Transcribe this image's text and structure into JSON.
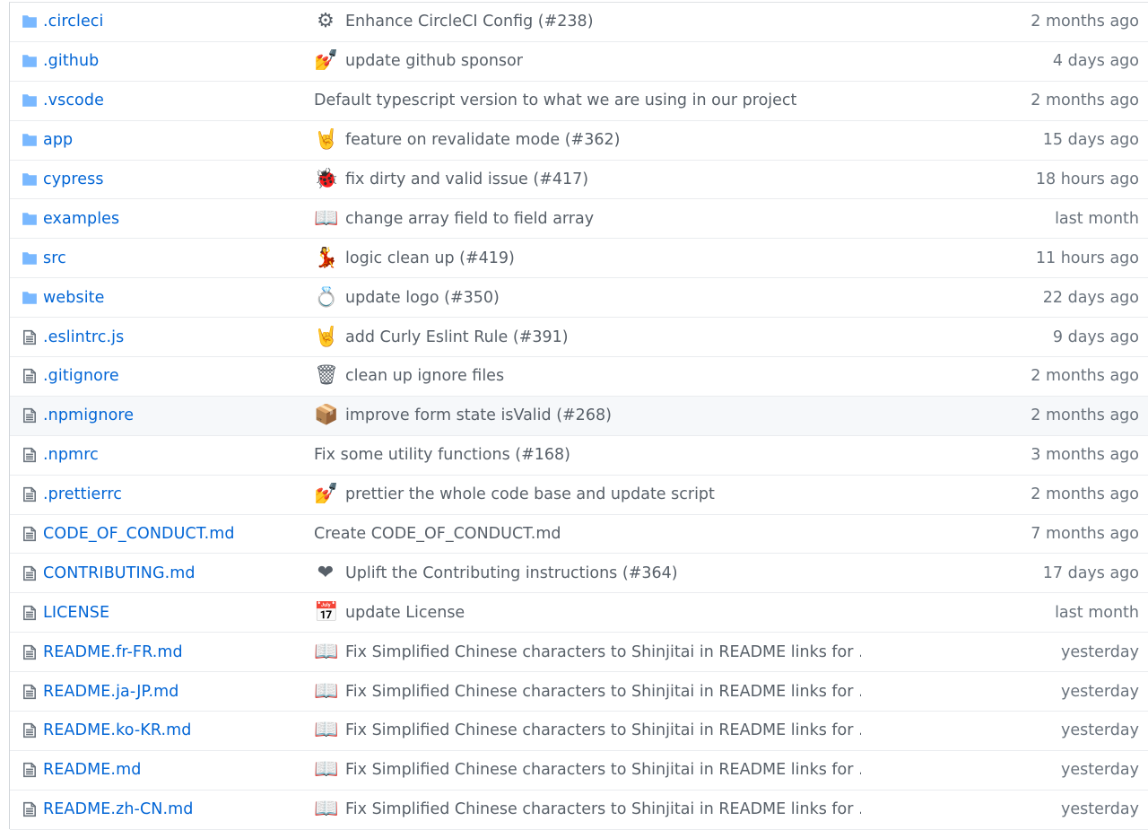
{
  "files": [
    {
      "name": ".circleci",
      "type": "folder",
      "emoji": "⚙",
      "message": "Enhance CircleCI Config (#238)",
      "age": "2 months ago"
    },
    {
      "name": ".github",
      "type": "folder",
      "emoji": "💅",
      "message": "update github sponsor",
      "age": "4 days ago"
    },
    {
      "name": ".vscode",
      "type": "folder",
      "emoji": "",
      "message": "Default typescript version to what we are using in our project",
      "age": "2 months ago"
    },
    {
      "name": "app",
      "type": "folder",
      "emoji": "🤘",
      "message": "feature on revalidate mode (#362)",
      "age": "15 days ago"
    },
    {
      "name": "cypress",
      "type": "folder",
      "emoji": "🐞",
      "message": "fix dirty and valid issue (#417)",
      "age": "18 hours ago"
    },
    {
      "name": "examples",
      "type": "folder",
      "emoji": "📖",
      "message": "change array field to field array",
      "age": "last month"
    },
    {
      "name": "src",
      "type": "folder",
      "emoji": "💃",
      "message": "logic clean up (#419)",
      "age": "11 hours ago"
    },
    {
      "name": "website",
      "type": "folder",
      "emoji": "💍",
      "message": "update logo (#350)",
      "age": "22 days ago"
    },
    {
      "name": ".eslintrc.js",
      "type": "file",
      "emoji": "🤘",
      "message": "add Curly Eslint Rule (#391)",
      "age": "9 days ago"
    },
    {
      "name": ".gitignore",
      "type": "file",
      "emoji": "🗑",
      "message": "clean up ignore files",
      "age": "2 months ago"
    },
    {
      "name": ".npmignore",
      "type": "file",
      "emoji": "📦",
      "message": "improve form state isValid (#268)",
      "age": "2 months ago"
    },
    {
      "name": ".npmrc",
      "type": "file",
      "emoji": "",
      "message": "Fix some utility functions (#168)",
      "age": "3 months ago"
    },
    {
      "name": ".prettierrc",
      "type": "file",
      "emoji": "💅",
      "message": "prettier the whole code base and update script",
      "age": "2 months ago"
    },
    {
      "name": "CODE_OF_CONDUCT.md",
      "type": "file",
      "emoji": "",
      "message": "Create CODE_OF_CONDUCT.md",
      "age": "7 months ago"
    },
    {
      "name": "CONTRIBUTING.md",
      "type": "file",
      "emoji": "❤",
      "message": "Uplift the Contributing instructions (#364)",
      "age": "17 days ago"
    },
    {
      "name": "LICENSE",
      "type": "file",
      "emoji": "📅",
      "message": "update License",
      "age": "last month"
    },
    {
      "name": "README.fr-FR.md",
      "type": "file",
      "emoji": "📖",
      "message": "Fix Simplified Chinese characters to Shinjitai in README links for …",
      "age": "yesterday"
    },
    {
      "name": "README.ja-JP.md",
      "type": "file",
      "emoji": "📖",
      "message": "Fix Simplified Chinese characters to Shinjitai in README links for …",
      "age": "yesterday"
    },
    {
      "name": "README.ko-KR.md",
      "type": "file",
      "emoji": "📖",
      "message": "Fix Simplified Chinese characters to Shinjitai in README links for …",
      "age": "yesterday"
    },
    {
      "name": "README.md",
      "type": "file",
      "emoji": "📖",
      "message": "Fix Simplified Chinese characters to Shinjitai in README links for …",
      "age": "yesterday"
    },
    {
      "name": "README.zh-CN.md",
      "type": "file",
      "emoji": "📖",
      "message": "Fix Simplified Chinese characters to Shinjitai in README links for …",
      "age": "yesterday"
    }
  ],
  "colors": {
    "link": "#0366d6",
    "folder_icon": "#79b8ff",
    "muted": "#586069",
    "border": "#eaecef",
    "hover_row": "#f6f8fa"
  }
}
